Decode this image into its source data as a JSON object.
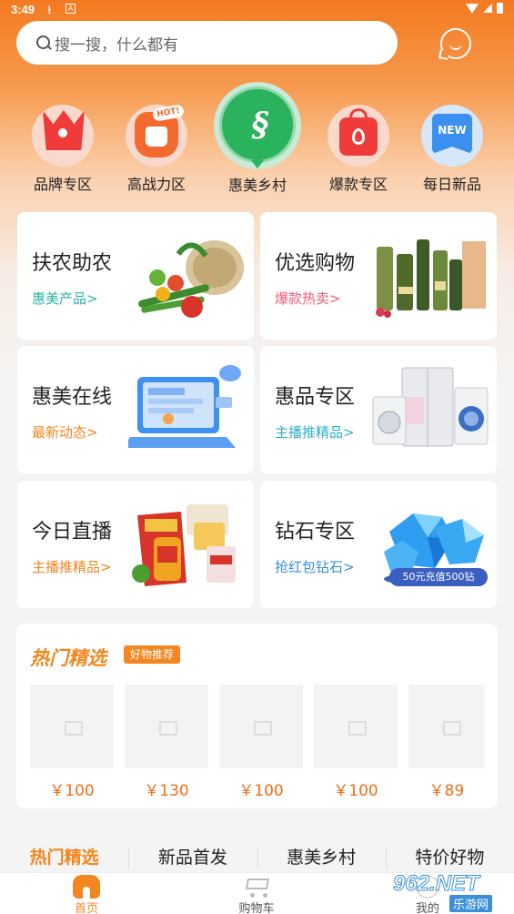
{
  "status_bar": {
    "time": "3:49",
    "icon_a": "A"
  },
  "search": {
    "placeholder": "搜一搜，什么都有"
  },
  "categories": [
    {
      "label": "品牌专区",
      "icon": "crown-icon"
    },
    {
      "label": "高战力区",
      "icon": "fist-icon",
      "badge": "HOT!"
    },
    {
      "label": "惠美乡村",
      "icon": "village-logo-icon"
    },
    {
      "label": "爆款专区",
      "icon": "shopping-bag-icon"
    },
    {
      "label": "每日新品",
      "icon": "new-badge-icon",
      "badge": "NEW"
    }
  ],
  "feature_cards": [
    {
      "title": "扶农助农",
      "subtitle": "惠美产品>",
      "subtitle_color": "#2bb3a4"
    },
    {
      "title": "优选购物",
      "subtitle": "爆款热卖>",
      "subtitle_color": "#ec5d7a"
    },
    {
      "title": "惠美在线",
      "subtitle": "最新动态>",
      "subtitle_color": "#f3861f"
    },
    {
      "title": "惠品专区",
      "subtitle": "主播推精品>",
      "subtitle_color": "#2cb0c8"
    },
    {
      "title": "今日直播",
      "subtitle": "主播推精品>",
      "subtitle_color": "#f3861f"
    },
    {
      "title": "钻石专区",
      "subtitle": "抢红包钻石>",
      "subtitle_color": "#3a8fd8",
      "art_badge": "50元充值500钻"
    }
  ],
  "hot_picks": {
    "title": "热门精选",
    "tag": "好物推荐",
    "products": [
      {
        "price": "￥100"
      },
      {
        "price": "￥130"
      },
      {
        "price": "￥100"
      },
      {
        "price": "￥100"
      },
      {
        "price": "￥89"
      }
    ]
  },
  "tabs": [
    {
      "label": "热门精选",
      "active": true
    },
    {
      "label": "新品首发",
      "active": false
    },
    {
      "label": "惠美乡村",
      "active": false
    },
    {
      "label": "特价好物",
      "active": false
    }
  ],
  "bottom_nav": [
    {
      "label": "首页",
      "active": true
    },
    {
      "label": "购物车",
      "active": false
    },
    {
      "label": "我的",
      "active": false
    }
  ],
  "watermark": {
    "main": "962.NET",
    "sub": "乐游网"
  },
  "colors": {
    "accent": "#f3861f",
    "price": "#f06d16"
  }
}
